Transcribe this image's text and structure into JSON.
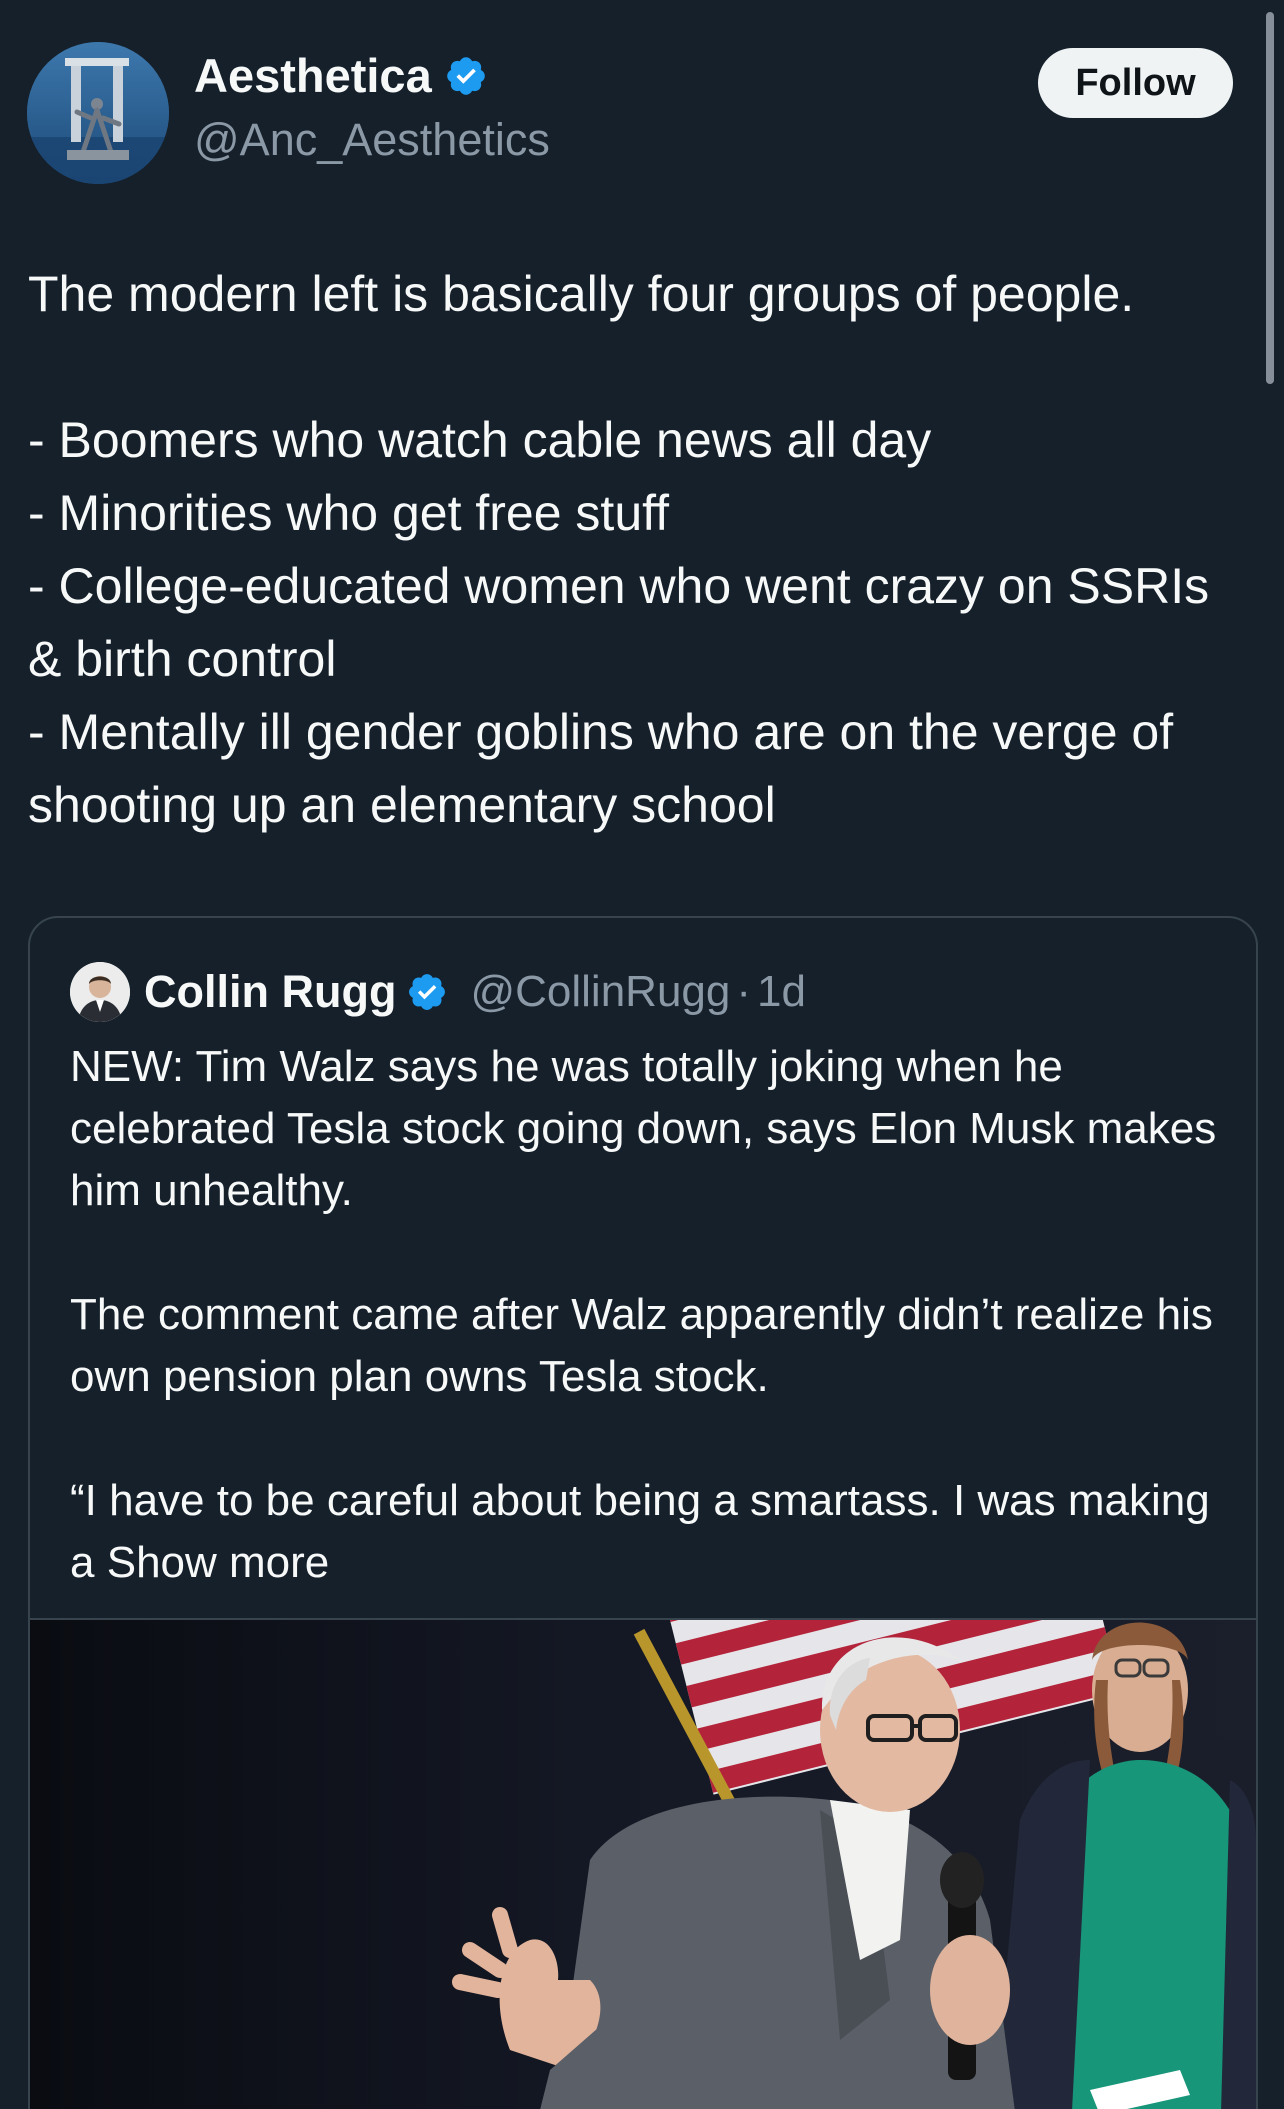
{
  "colors": {
    "background": "#15202b",
    "text_primary": "#f7f9f9",
    "text_secondary": "#8b98a5",
    "verified_blue": "#1d9bf0",
    "follow_button_bg": "#eff3f4",
    "border": "#38444d"
  },
  "author": {
    "display_name": "Aesthetica",
    "handle": "@Anc_Aesthetics",
    "verified_icon": "verified-badge-icon",
    "avatar_icon": "statue-avatar"
  },
  "follow_button": {
    "label": "Follow"
  },
  "post": {
    "intro": "The modern left is basically four groups of people.",
    "items": [
      "- Boomers who watch cable news all day",
      "- Minorities who get free stuff",
      "- College-educated women who went crazy on SSRIs & birth control",
      "- Mentally ill gender goblins who are on the verge of shooting up an elementary school"
    ]
  },
  "quoted_post": {
    "display_name": "Collin Rugg",
    "handle": "@CollinRugg",
    "separator": "·",
    "time": "1d",
    "paragraph_1": "NEW: Tim Walz says he was totally joking when he celebrated Tesla stock going down, says Elon Musk makes him unhealthy.",
    "paragraph_2": "The comment came after Walz apparently didn’t realize his own pension plan owns Tesla stock.",
    "paragraph_3_start": "“I have to be careful about being a smartass. I was making a",
    "show_more": "Show more",
    "media_icon": "video-thumbnail"
  }
}
